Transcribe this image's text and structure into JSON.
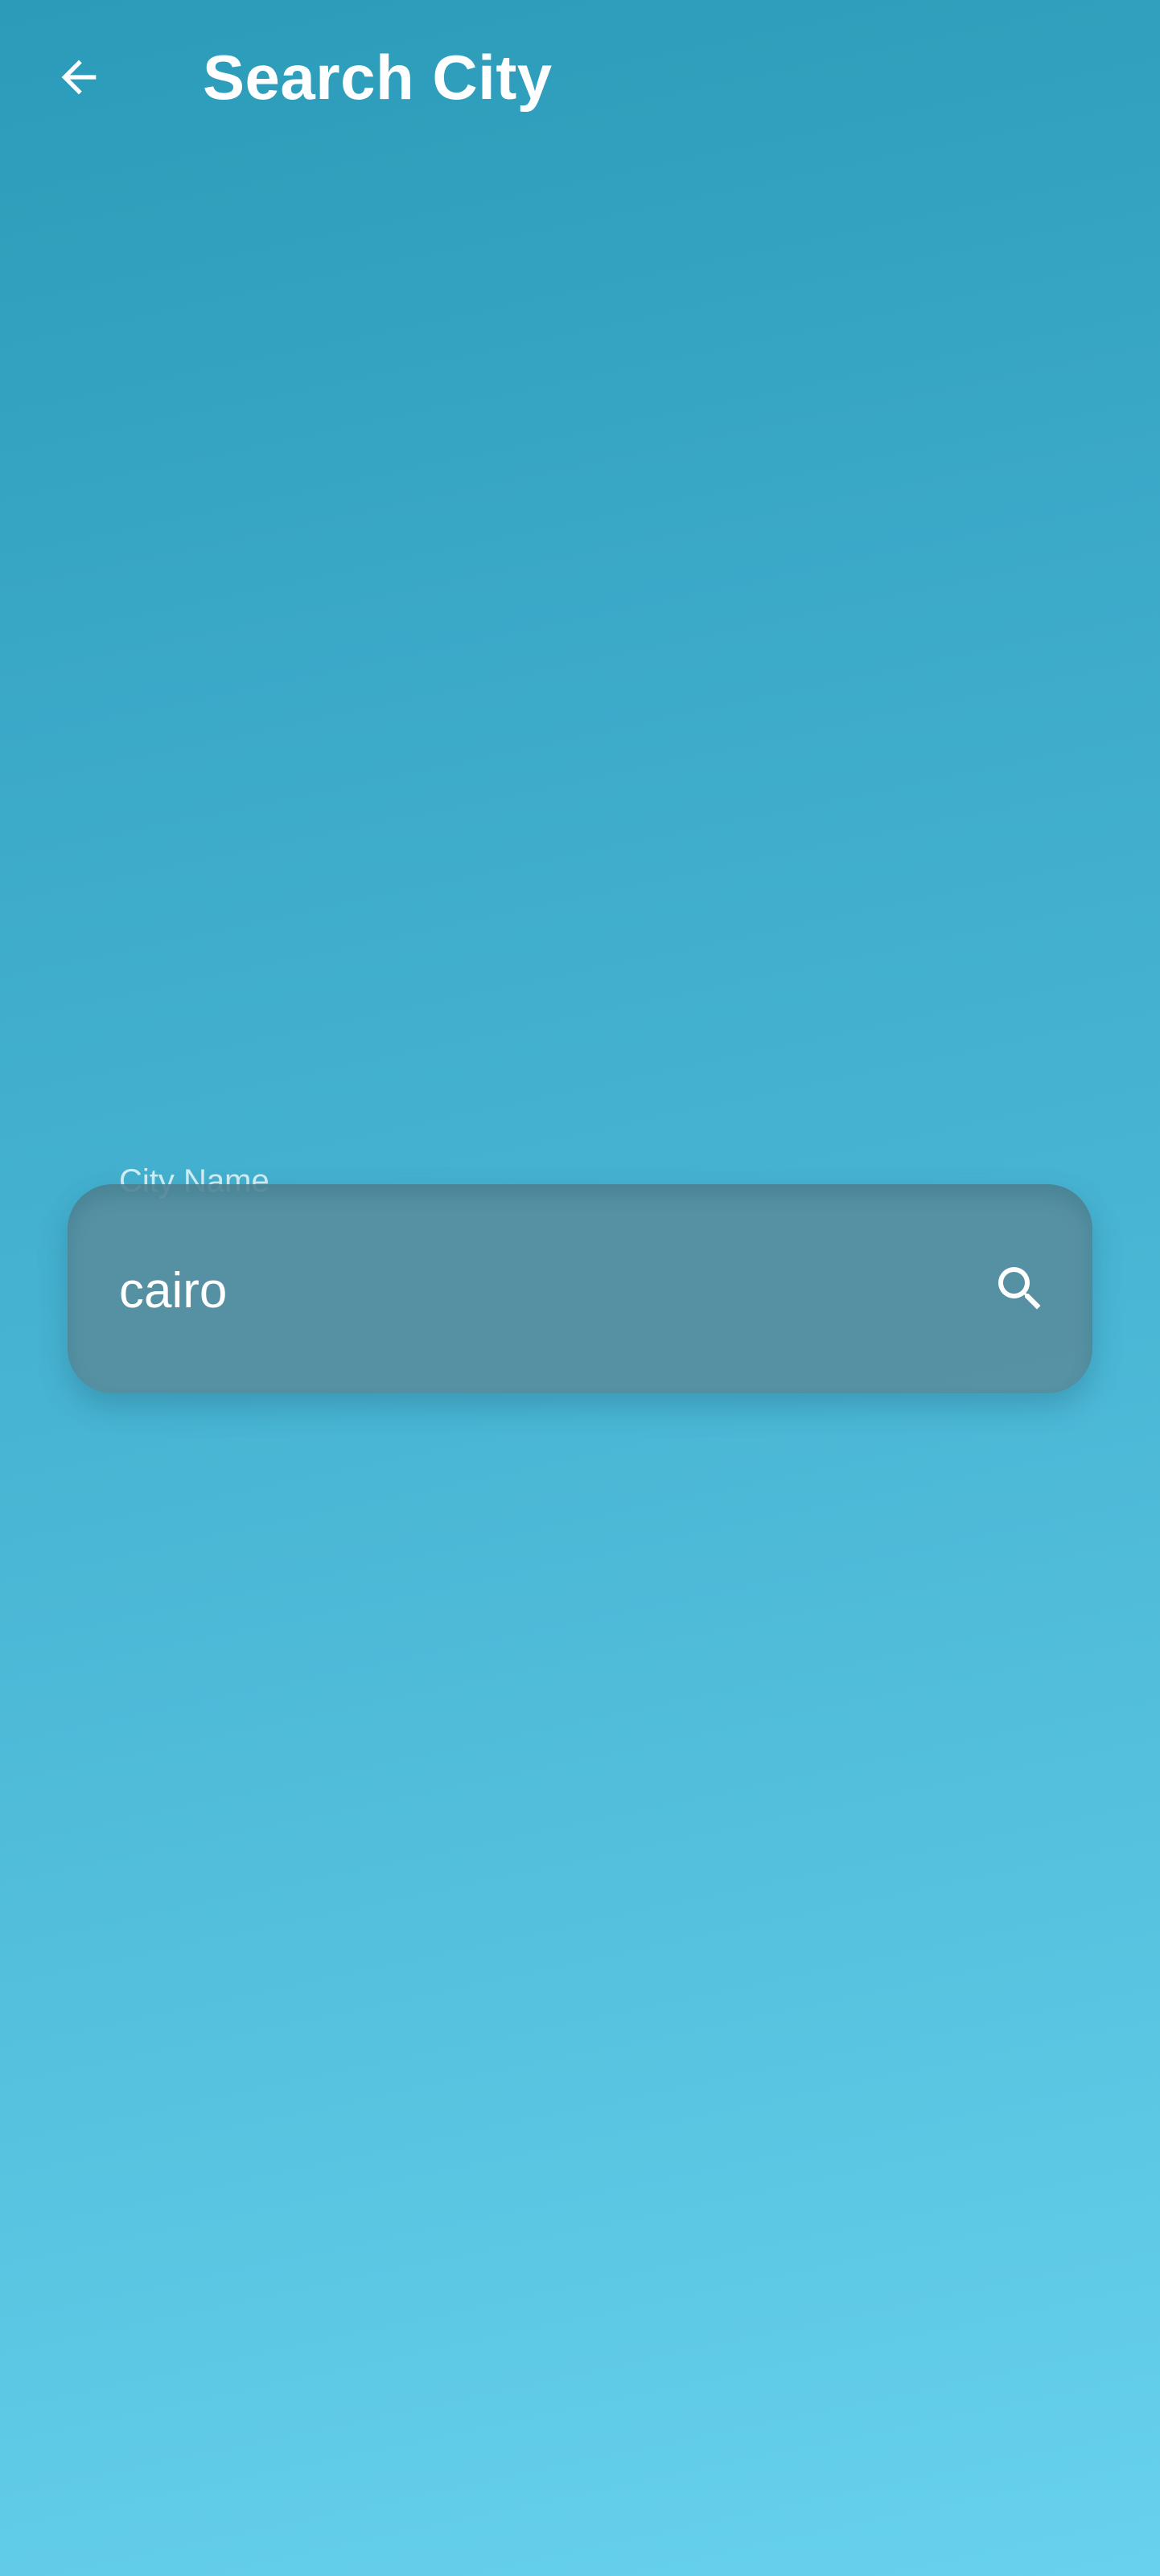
{
  "app_bar": {
    "back_icon": "arrow-back-icon",
    "title": "Search City"
  },
  "search": {
    "label": "City Name",
    "value": "cairo",
    "icon": "search-icon"
  }
}
